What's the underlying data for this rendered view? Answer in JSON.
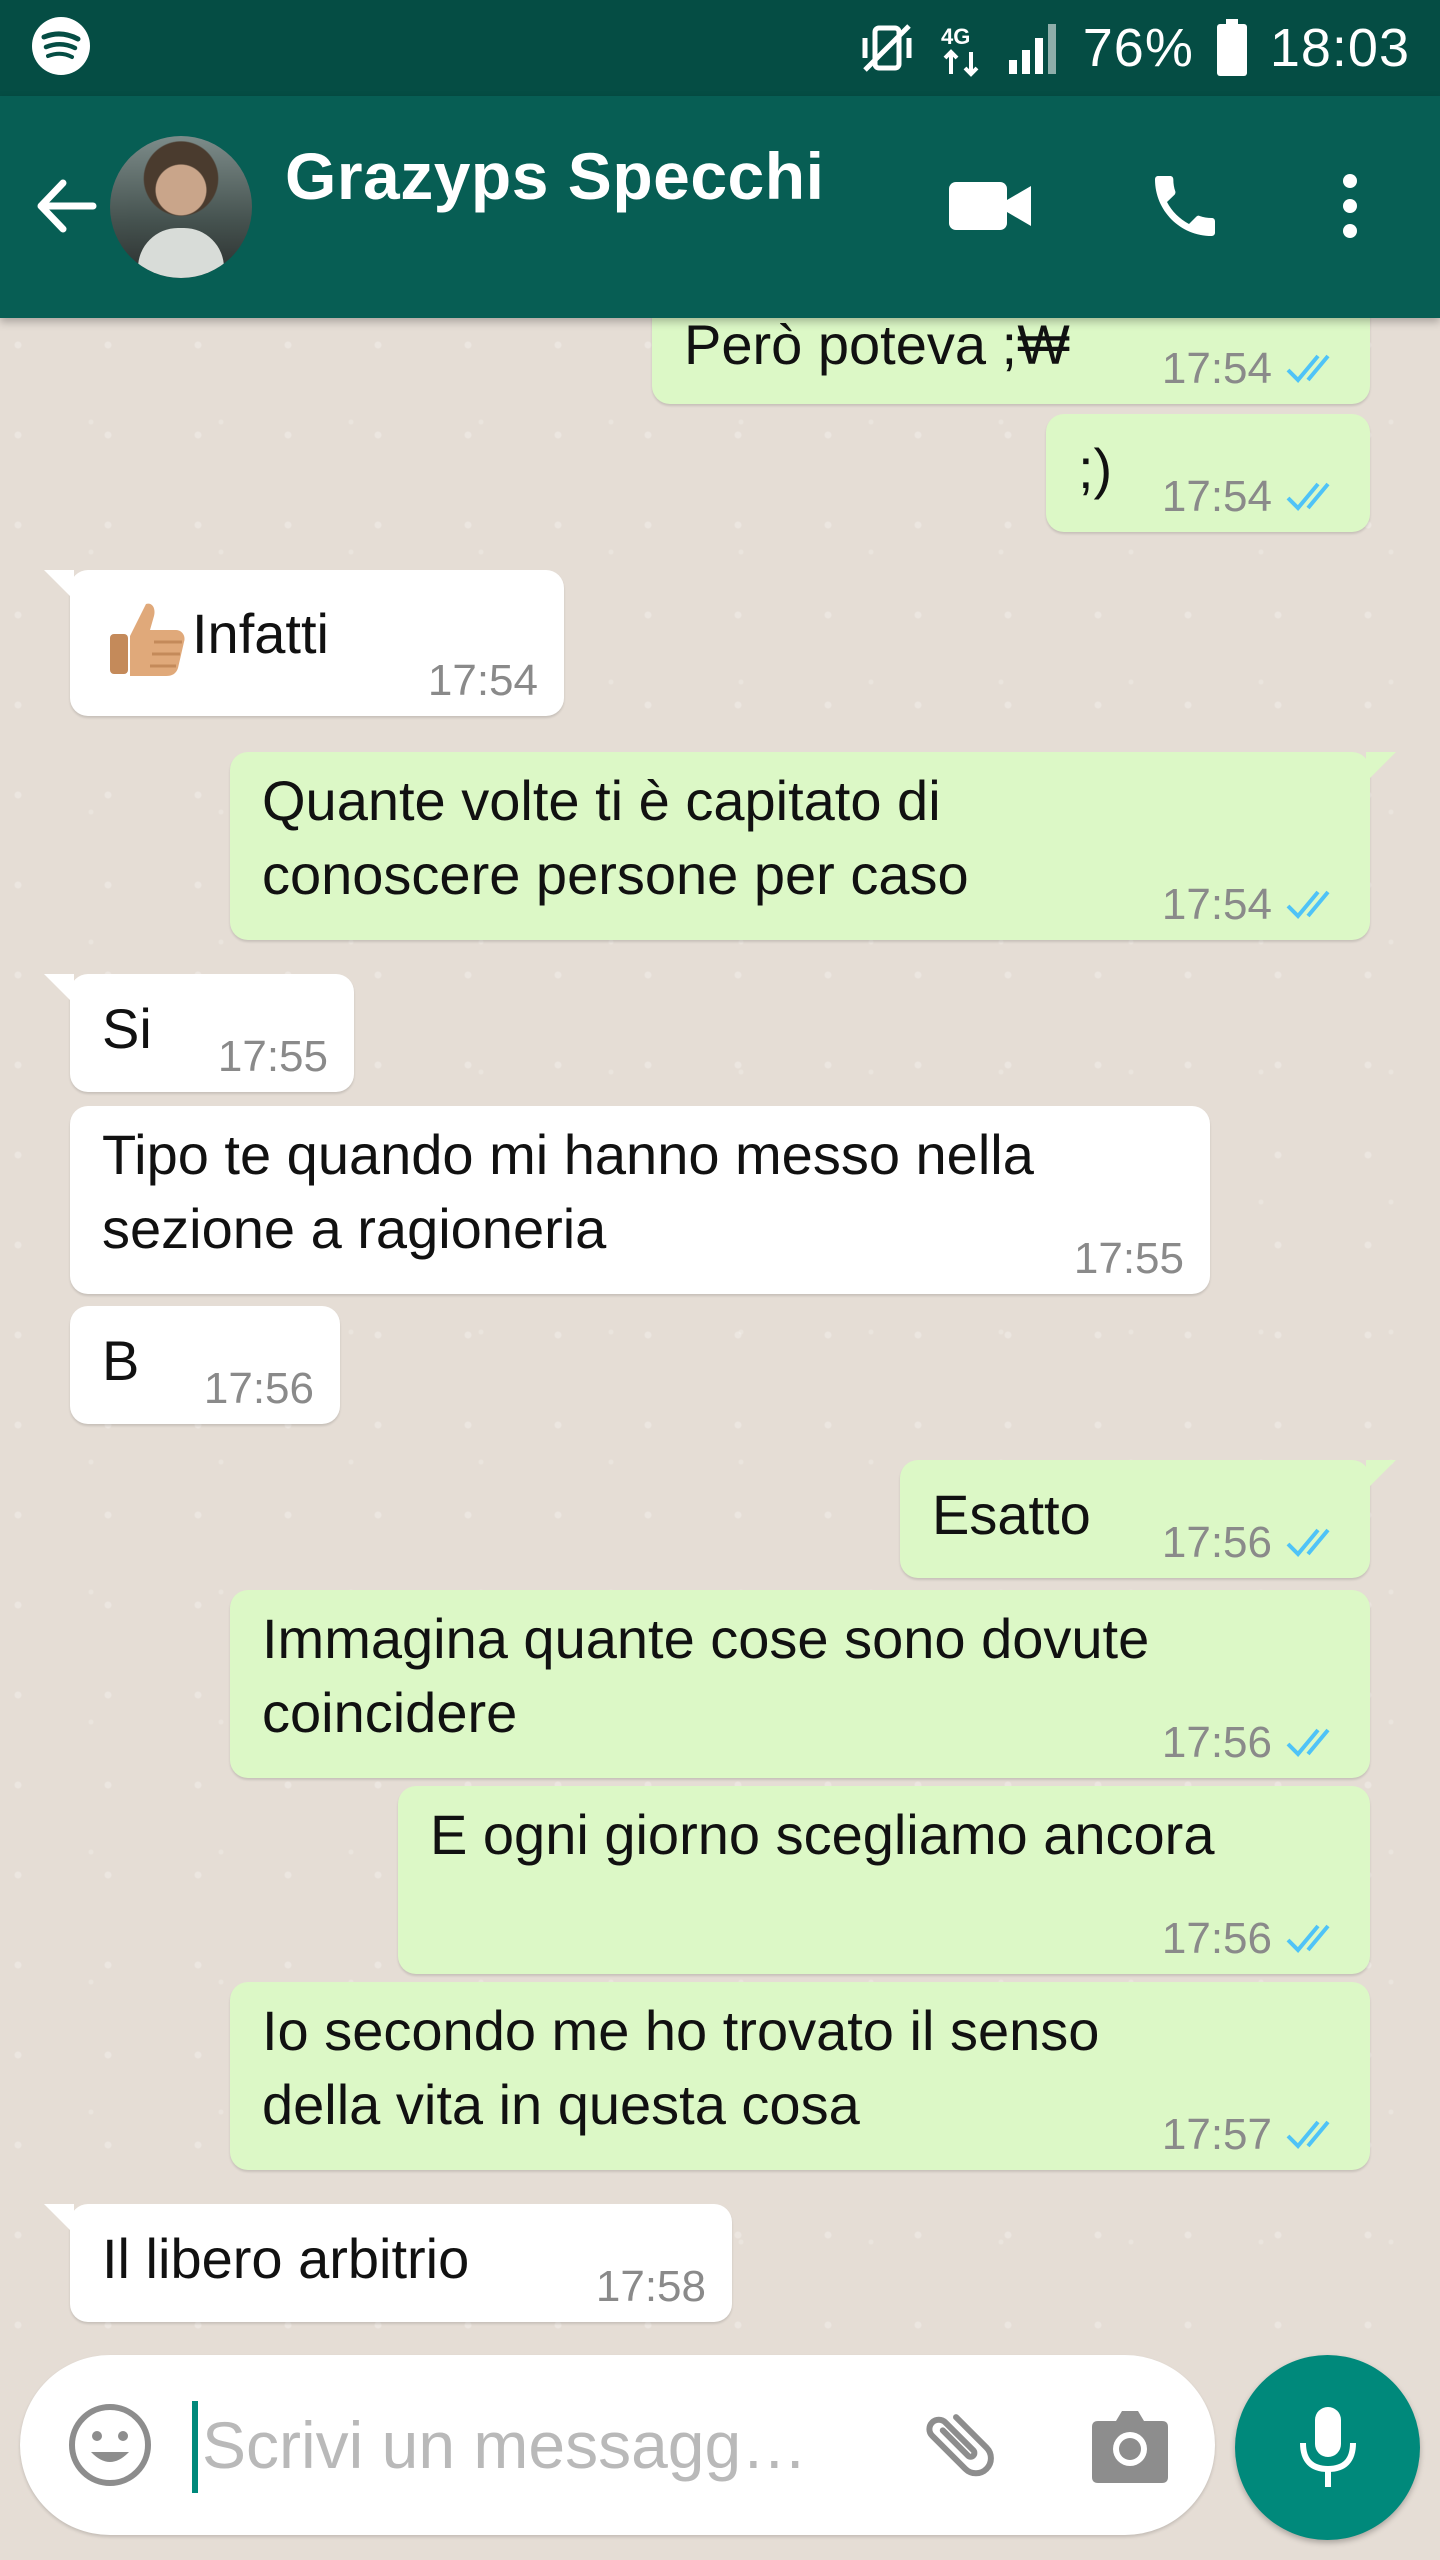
{
  "status_bar": {
    "battery": "76%",
    "time": "18:03",
    "network": "4G",
    "icons": [
      "spotify-icon",
      "vibrate-mute-icon",
      "4g-icon",
      "signal-icon",
      "battery-icon"
    ]
  },
  "header": {
    "contact_name": "Grazyps Specchi",
    "icons": [
      "back-arrow-icon",
      "avatar",
      "video-call-icon",
      "phone-icon",
      "more-vert-icon"
    ]
  },
  "messages": [
    {
      "direction": "out",
      "text": "Però poteva ;₩",
      "time": "17:54",
      "read": true
    },
    {
      "direction": "out",
      "text": ";)",
      "time": "17:54",
      "read": true
    },
    {
      "direction": "in",
      "text": "Infatti",
      "emoji": "thumbs-up",
      "time": "17:54"
    },
    {
      "direction": "out",
      "lines": [
        "Quante volte ti è capitato di",
        "conoscere persone per caso"
      ],
      "time": "17:54",
      "read": true
    },
    {
      "direction": "in",
      "text": "Si",
      "time": "17:55"
    },
    {
      "direction": "in",
      "lines": [
        "Tipo te quando mi hanno messo nella",
        "sezione a ragioneria"
      ],
      "time": "17:55"
    },
    {
      "direction": "in",
      "text": "B",
      "time": "17:56"
    },
    {
      "direction": "out",
      "text": "Esatto",
      "time": "17:56",
      "read": true
    },
    {
      "direction": "out",
      "lines": [
        "Immagina quante cose sono dovute",
        "coincidere"
      ],
      "time": "17:56",
      "read": true
    },
    {
      "direction": "out",
      "text": "E ogni giorno scegliamo ancora",
      "time": "17:56",
      "read": true
    },
    {
      "direction": "out",
      "lines": [
        "Io secondo me ho trovato il senso",
        "della vita in questa cosa"
      ],
      "time": "17:57",
      "read": true
    },
    {
      "direction": "in",
      "text": "Il libero arbitrio",
      "time": "17:58"
    }
  ],
  "composer": {
    "placeholder": "Scrivi un messagg…",
    "icons": [
      "emoji-icon",
      "attach-icon",
      "camera-icon",
      "mic-icon"
    ]
  },
  "colors": {
    "status_bar": "#054d44",
    "app_bar": "#075e54",
    "chat_background": "#e5ddd5",
    "outgoing_bubble": "#dcf8c6",
    "incoming_bubble": "#ffffff",
    "read_ticks": "#4fc3f7",
    "mic_button": "#00897b"
  }
}
